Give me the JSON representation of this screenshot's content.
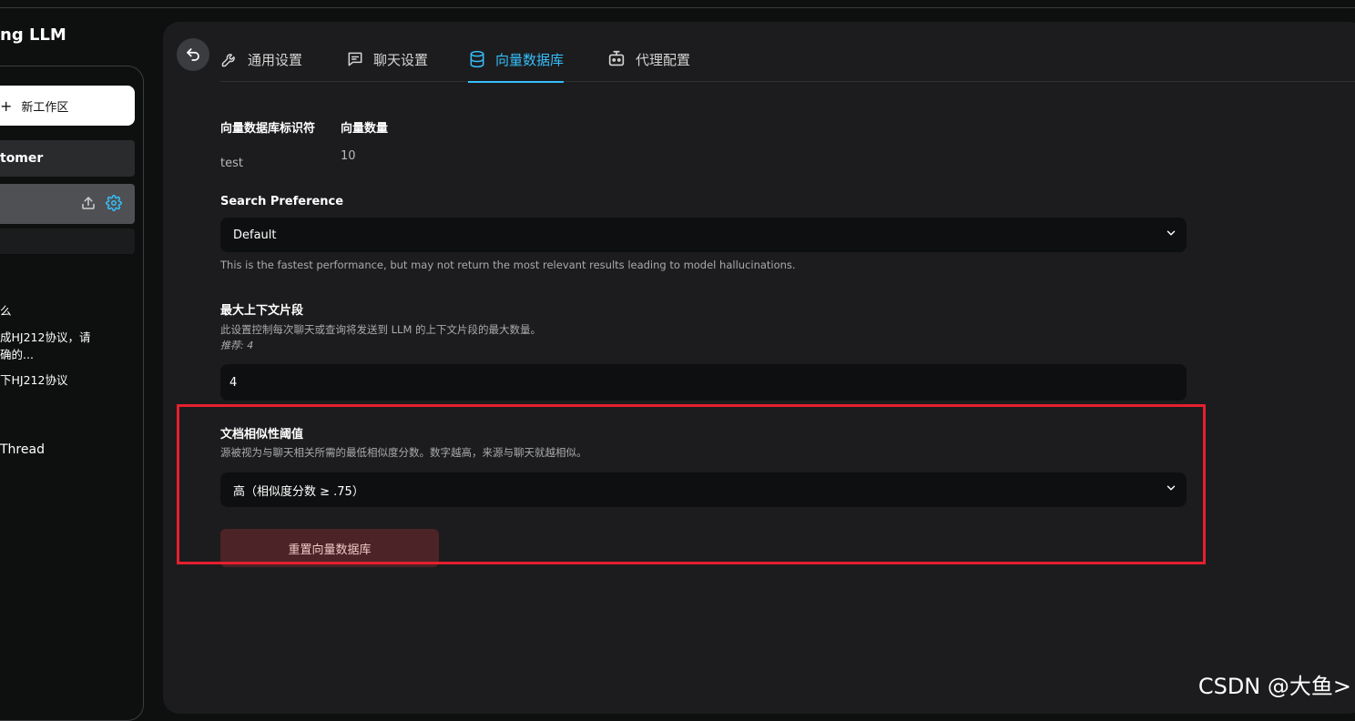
{
  "sidebar": {
    "brand": "ng LLM",
    "new_workspace_label": "新工作区",
    "workspaces": [
      {
        "label": "tomer"
      },
      {
        "label": ""
      },
      {
        "label": ""
      }
    ],
    "threads": [
      {
        "line1": "么",
        "line2": ""
      },
      {
        "line1": "成HJ212协议，请",
        "line2": "确的..."
      },
      {
        "line1": "下HJ212协议",
        "line2": ""
      },
      {
        "line1": "Thread",
        "line2": ""
      }
    ]
  },
  "tabs": [
    {
      "label": "通用设置",
      "icon": "wrench-icon"
    },
    {
      "label": "聊天设置",
      "icon": "chat-icon"
    },
    {
      "label": "向量数据库",
      "icon": "database-icon",
      "active": true
    },
    {
      "label": "代理配置",
      "icon": "robot-icon"
    }
  ],
  "vector_db": {
    "identifier_label": "向量数据库标识符",
    "identifier_value": "test",
    "count_label": "向量数量",
    "count_value": "10"
  },
  "search_preference": {
    "label": "Search Preference",
    "selected": "Default",
    "description": "This is the fastest performance, but may not return the most relevant results leading to model hallucinations."
  },
  "max_context": {
    "label": "最大上下文片段",
    "description": "此设置控制每次聊天或查询将发送到 LLM 的上下文片段的最大数量。",
    "recommend": "推荐: 4",
    "value": "4"
  },
  "similarity_threshold": {
    "label": "文档相似性阈值",
    "description": "源被视为与聊天相关所需的最低相似度分数。数字越高，来源与聊天就越相似。",
    "selected": "高（相似度分数 ≥ .75）"
  },
  "reset_button_label": "重置向量数据库",
  "watermark": "CSDN @大鱼>",
  "colors": {
    "accent": "#36bffa",
    "highlight_border": "#e5202e",
    "danger_button": "#4c2326"
  }
}
